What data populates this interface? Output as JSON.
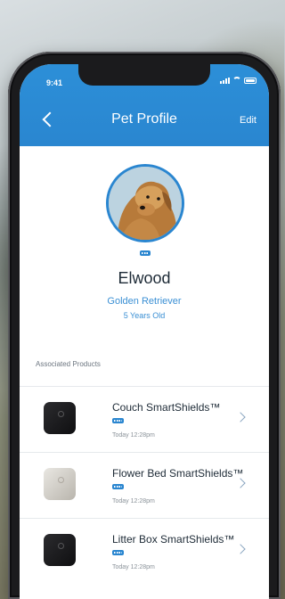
{
  "status_bar": {
    "time": "9:41"
  },
  "header": {
    "title": "Pet Profile",
    "edit_label": "Edit"
  },
  "pet": {
    "name": "Elwood",
    "breed": "Golden Retriever",
    "age": "5 Years Old"
  },
  "products_section": {
    "label": "Associated Products",
    "items": [
      {
        "name": "Couch SmartShields™",
        "time": "Today 12:28pm",
        "color": "#1a1a1c"
      },
      {
        "name": "Flower Bed SmartShields™",
        "time": "Today 12:28pm",
        "color": "#cfccc5"
      },
      {
        "name": "Litter Box SmartShields™",
        "time": "Today 12:28pm",
        "color": "#1a1a1c"
      }
    ]
  },
  "colors": {
    "accent": "#2a86d0"
  }
}
